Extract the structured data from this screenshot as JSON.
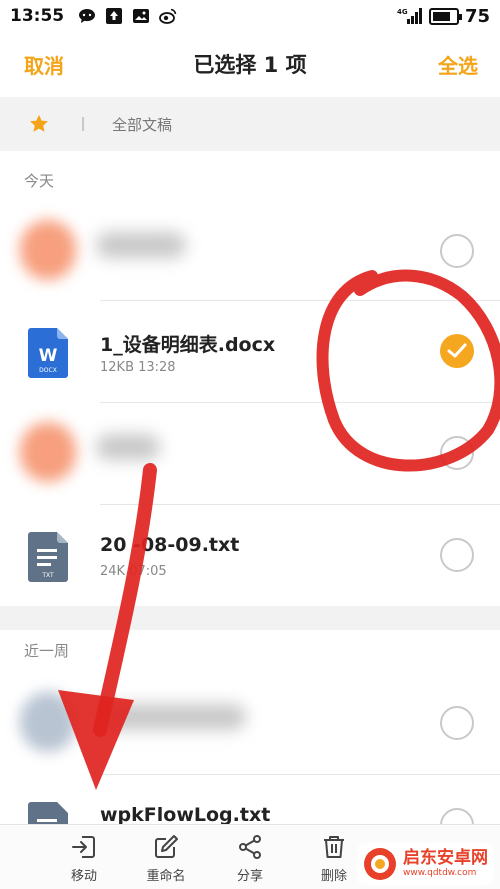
{
  "status_bar": {
    "time": "13:55",
    "network": "4G",
    "battery": "75"
  },
  "header": {
    "cancel_label": "取消",
    "title": "已选择 1 项",
    "select_all_label": "全选"
  },
  "breadcrumb": {
    "label": "全部文稿"
  },
  "sections": [
    {
      "title": "今天",
      "files": [
        {
          "name": "",
          "meta": "",
          "icon": "blurred-thumbnail",
          "checked": false,
          "blurred": true
        },
        {
          "name": "1_设备明细表.docx",
          "meta": "12KB  13:28",
          "icon": "word-docx-icon",
          "icon_text": "W",
          "icon_sub": "DOCX",
          "checked": true,
          "blurred": false
        },
        {
          "name": "",
          "meta": "",
          "icon": "blurred-thumbnail",
          "checked": false,
          "blurred": true
        },
        {
          "name": "20  -08-09.txt",
          "meta": "24K   07:05",
          "icon": "txt-file-icon",
          "icon_sub": "TXT",
          "checked": false,
          "blurred": false
        }
      ]
    },
    {
      "title": "近一周",
      "files": [
        {
          "name": "",
          "meta": "",
          "icon": "blurred-thumbnail",
          "checked": false,
          "blurred": true
        },
        {
          "name": "wpkFlowLog.txt",
          "meta": "",
          "icon": "txt-file-icon",
          "checked": false,
          "blurred": false
        }
      ]
    }
  ],
  "toolbar": {
    "move_label": "移动",
    "rename_label": "重命名",
    "share_label": "分享",
    "delete_label": "删除"
  },
  "watermark": {
    "name": "启东安卓网",
    "url": "www.qdtdw.com"
  },
  "colors": {
    "accent": "#f3a418",
    "checked": "#f5a720",
    "word_blue": "#2b6fd6",
    "txt_slate": "#5f7288",
    "annotation_red": "#e0241f"
  }
}
